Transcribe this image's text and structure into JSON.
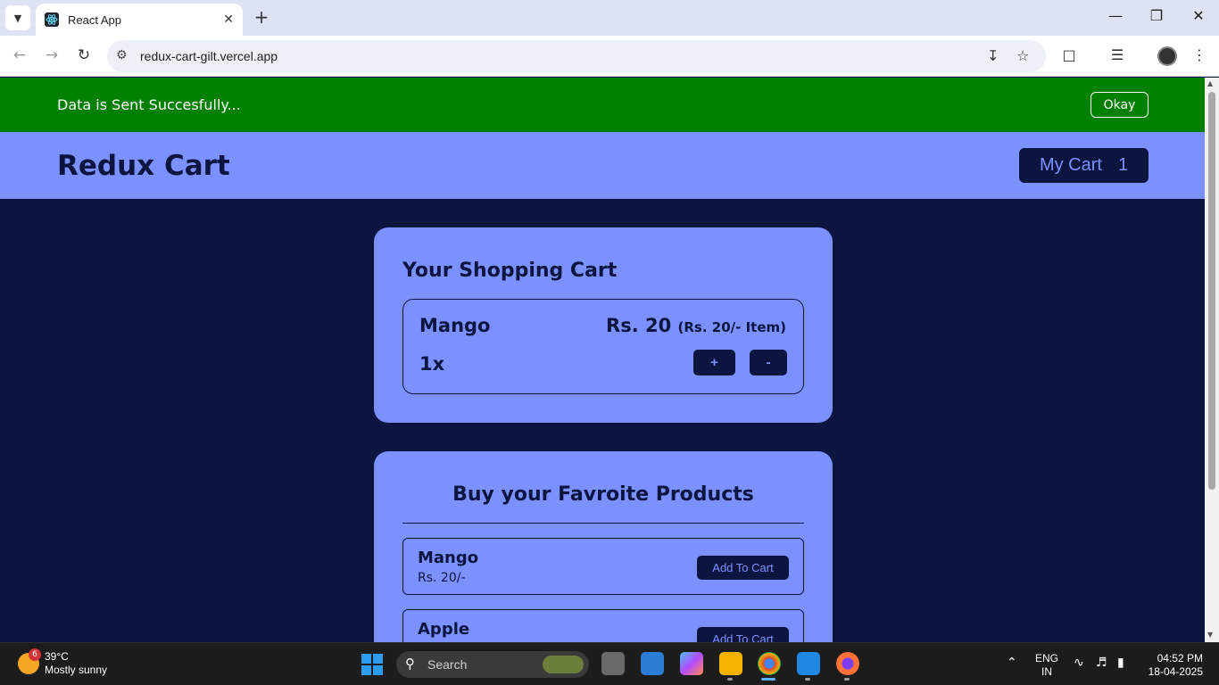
{
  "browser": {
    "tab_title": "React App",
    "url": "redux-cart-gilt.vercel.app"
  },
  "notification": {
    "message": "Data is Sent Succesfully...",
    "okay_label": "Okay",
    "color": "#008000"
  },
  "header": {
    "brand": "Redux Cart",
    "cart_label": "My Cart",
    "cart_count": "1"
  },
  "cart": {
    "title": "Your Shopping Cart",
    "items": [
      {
        "name": "Mango",
        "price": "Rs. 20",
        "unit_price": "(Rs. 20/- Item)",
        "qty": "1x",
        "plus": "+",
        "minus": "-"
      }
    ]
  },
  "products": {
    "title": "Buy your Favroite Products",
    "items": [
      {
        "name": "Mango",
        "price": "Rs. 20/-",
        "button": "Add To Cart"
      },
      {
        "name": "Apple",
        "price": "",
        "button": "Add To Cart"
      }
    ]
  },
  "colors": {
    "page_bg": "#0b1540",
    "accent": "#7b91ff"
  },
  "taskbar": {
    "weather_badge": "6",
    "temperature": "39°C",
    "condition": "Mostly sunny",
    "search_placeholder": "Search",
    "language": "ENG",
    "region": "IN",
    "time": "04:52 PM",
    "date": "18-04-2025"
  }
}
